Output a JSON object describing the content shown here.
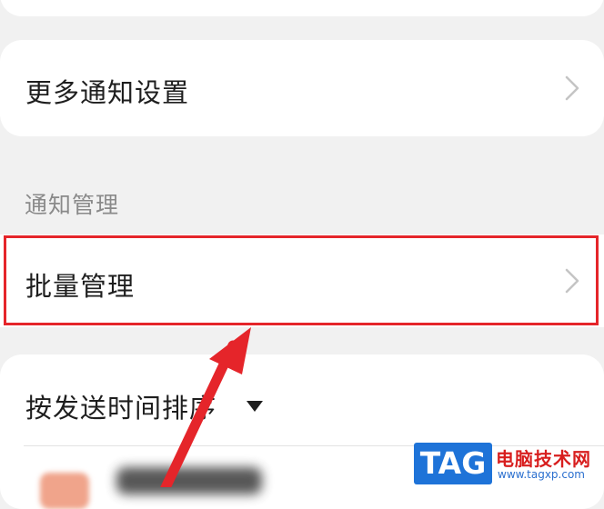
{
  "settings": {
    "more_notification_settings": "更多通知设置",
    "section_notification_management": "通知管理",
    "batch_management": "批量管理",
    "sort_by_send_time": "按发送时间排序"
  },
  "watermark": {
    "tag": "TAG",
    "site_name": "电脑技术网",
    "url": "www.tagxp.com"
  },
  "colors": {
    "highlight": "#e5252a",
    "annotation_arrow": "#e5252a",
    "watermark_blue": "#1e73d8"
  },
  "icons": {
    "chevron": "chevron-right-icon",
    "sort": "caret-down-icon"
  }
}
